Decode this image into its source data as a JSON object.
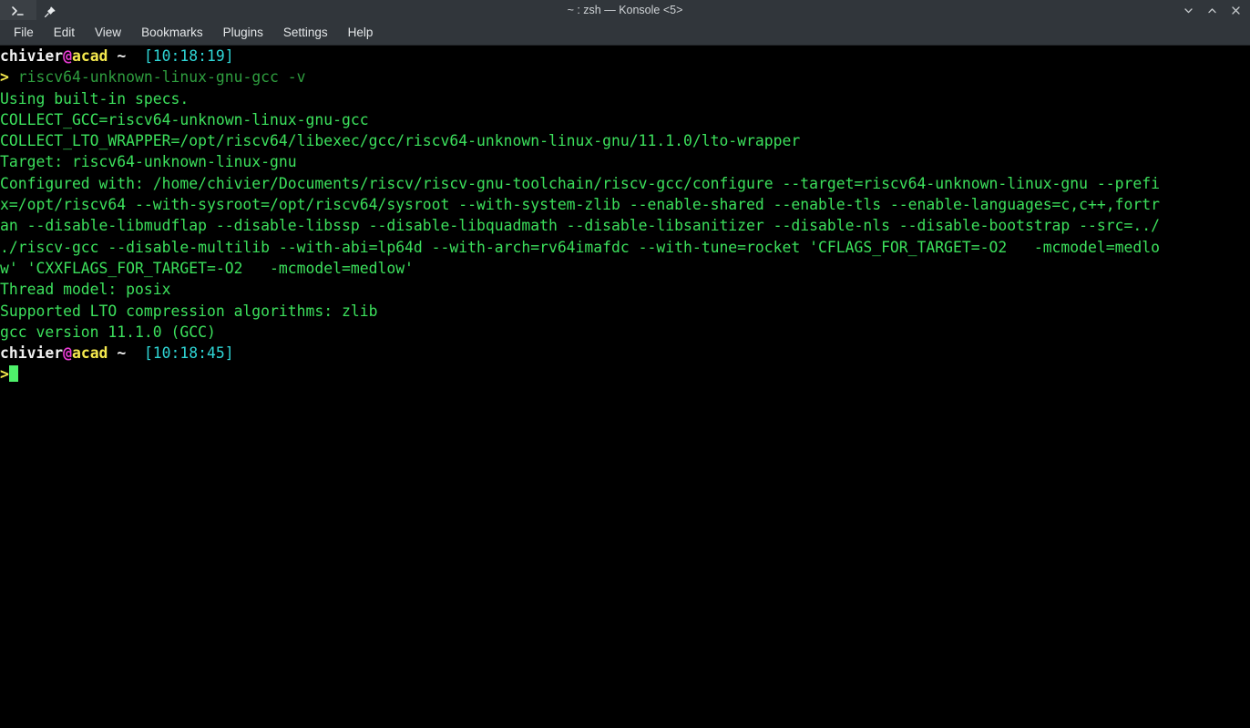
{
  "window": {
    "title": "~ : zsh — Konsole <5>",
    "tab_icon": "terminal-prompt-icon",
    "pin_icon": "pin-icon",
    "controls": [
      {
        "name": "minimize-button",
        "icon": "chevron-down-icon"
      },
      {
        "name": "maximize-button",
        "icon": "chevron-up-icon"
      },
      {
        "name": "close-button",
        "icon": "close-x-icon"
      }
    ]
  },
  "menubar": {
    "items": [
      {
        "label": "File"
      },
      {
        "label": "Edit"
      },
      {
        "label": "View"
      },
      {
        "label": "Bookmarks"
      },
      {
        "label": "Plugins"
      },
      {
        "label": "Settings"
      },
      {
        "label": "Help"
      }
    ]
  },
  "terminal": {
    "prompt1": {
      "user": "chivier",
      "at": "@",
      "host": "acad",
      "path": "~",
      "time": "[10:18:19]",
      "arrow": ">",
      "command": "riscv64-unknown-linux-gnu-gcc -v"
    },
    "output": [
      "Using built-in specs.",
      "COLLECT_GCC=riscv64-unknown-linux-gnu-gcc",
      "COLLECT_LTO_WRAPPER=/opt/riscv64/libexec/gcc/riscv64-unknown-linux-gnu/11.1.0/lto-wrapper",
      "Target: riscv64-unknown-linux-gnu",
      "Configured with: /home/chivier/Documents/riscv/riscv-gnu-toolchain/riscv-gcc/configure --target=riscv64-unknown-linux-gnu --prefi",
      "x=/opt/riscv64 --with-sysroot=/opt/riscv64/sysroot --with-system-zlib --enable-shared --enable-tls --enable-languages=c,c++,fortr",
      "an --disable-libmudflap --disable-libssp --disable-libquadmath --disable-libsanitizer --disable-nls --disable-bootstrap --src=../",
      "./riscv-gcc --disable-multilib --with-abi=lp64d --with-arch=rv64imafdc --with-tune=rocket 'CFLAGS_FOR_TARGET=-O2   -mcmodel=medlo",
      "w' 'CXXFLAGS_FOR_TARGET=-O2   -mcmodel=medlow'",
      "Thread model: posix",
      "Supported LTO compression algorithms: zlib",
      "gcc version 11.1.0 (GCC)"
    ],
    "prompt2": {
      "user": "chivier",
      "at": "@",
      "host": "acad",
      "path": "~",
      "time": "[10:18:45]",
      "arrow": ">",
      "command": ""
    }
  },
  "colors": {
    "titlebar_bg": "#31363b",
    "terminal_bg": "#000000",
    "output_green": "#3ce05c",
    "command_green": "#2f9e3f",
    "host_yellow": "#f5e94e",
    "at_magenta": "#e93bd4",
    "time_cyan": "#2fd6d6",
    "cursor_green": "#4ef06a"
  }
}
